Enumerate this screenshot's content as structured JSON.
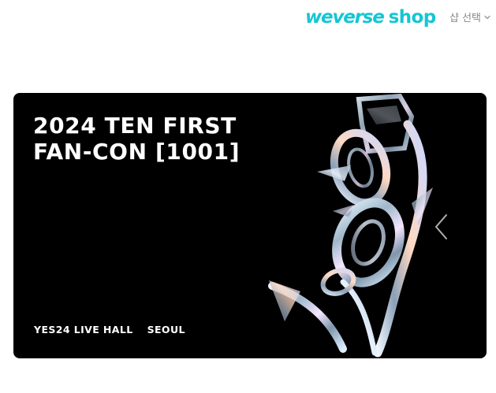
{
  "header": {
    "logo_main": "weverse",
    "logo_sub": "shop",
    "shop_select_label": "샵 선택"
  },
  "banner": {
    "title_line1": "2024 TEN FIRST",
    "title_line2": "FAN-CON [1001]",
    "venue": "YES24 LIVE HALL",
    "city": "SEOUL"
  },
  "colors": {
    "brand": "#15c6d3",
    "banner_bg": "#000000",
    "text_muted": "#8a8a8a"
  },
  "icons": {
    "chevron": "chevron-down-icon",
    "prev": "chevron-left-icon"
  }
}
